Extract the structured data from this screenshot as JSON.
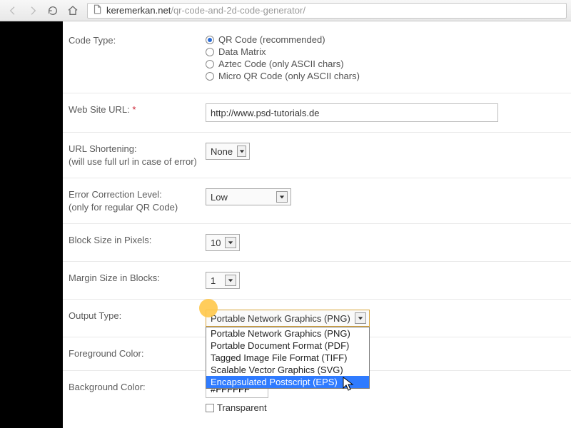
{
  "browser": {
    "url_host": "keremerkan.net",
    "url_path": "/qr-code-and-2d-code-generator/"
  },
  "form": {
    "code_type": {
      "label": "Code Type:",
      "options": [
        "QR Code (recommended)",
        "Data Matrix",
        "Aztec Code (only ASCII chars)",
        "Micro QR Code (only ASCII chars)"
      ],
      "selected_index": 0
    },
    "website_url": {
      "label": "Web Site URL:",
      "required_mark": "*",
      "value": "http://www.psd-tutorials.de"
    },
    "url_shortening": {
      "label": "URL Shortening:",
      "sublabel": "(will use full url in case of error)",
      "value": "None"
    },
    "error_correction": {
      "label": "Error Correction Level:",
      "sublabel": "(only for regular QR Code)",
      "value": "Low"
    },
    "block_size": {
      "label": "Block Size in Pixels:",
      "value": "10"
    },
    "margin_size": {
      "label": "Margin Size in Blocks:",
      "value": "1"
    },
    "output_type": {
      "label": "Output Type:",
      "value": "Portable Network Graphics (PNG)",
      "options": [
        "Portable Network Graphics (PNG)",
        "Portable Document Format (PDF)",
        "Tagged Image File Format (TIFF)",
        "Scalable Vector Graphics (SVG)",
        "Encapsulated Postscript (EPS)"
      ],
      "highlighted_index": 4
    },
    "foreground_color": {
      "label": "Foreground Color:"
    },
    "background_color": {
      "label": "Background Color:",
      "value": "#FFFFFF",
      "transparent_label": "Transparent"
    }
  }
}
